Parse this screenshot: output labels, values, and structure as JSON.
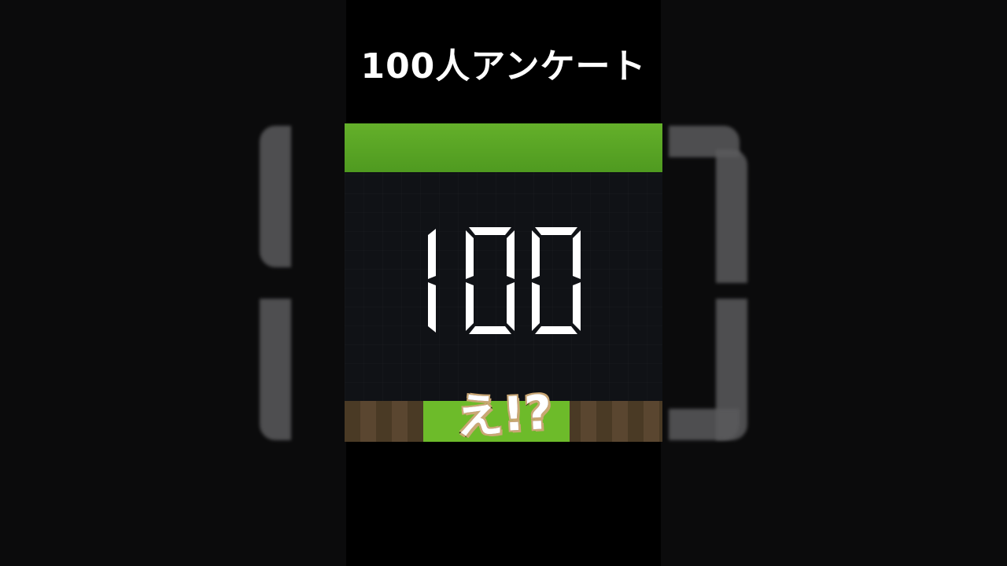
{
  "header": {
    "title": "100人アンケート"
  },
  "scene": {
    "counter_value": "100",
    "reaction_text": "え!?"
  },
  "colors": {
    "background": "#000000",
    "grass": "#5aa626",
    "counter_digit": "#ffffff",
    "reaction_outline": "#3a2a18"
  }
}
